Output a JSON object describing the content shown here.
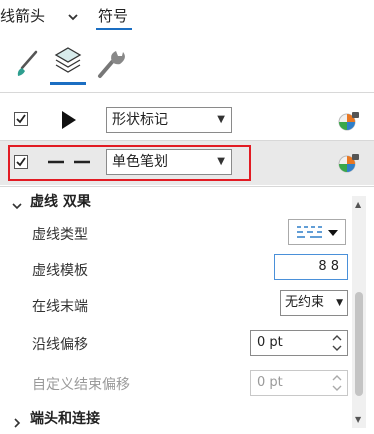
{
  "tabs": [
    {
      "label": "线箭头",
      "active": false
    },
    {
      "label": "符号",
      "active": true
    }
  ],
  "tab_dropdown_icon": "chevron-down-icon",
  "icon_tabs": [
    {
      "name": "brush-icon",
      "active": false
    },
    {
      "name": "layers-icon",
      "active": true
    },
    {
      "name": "wrench-icon",
      "active": false
    }
  ],
  "layers": [
    {
      "checked": true,
      "preview": "arrowhead",
      "type": "形状标记",
      "selected": false
    },
    {
      "checked": true,
      "preview": "dashed-line",
      "type": "单色笔划",
      "selected": true
    }
  ],
  "dash_effect": {
    "title": "虚线 双果",
    "dash_type_label": "虚线类型",
    "dash_template_label": "虚线模板",
    "dash_template_value": "8 8",
    "line_end_label": "在线末端",
    "line_end_value": "无约束",
    "offset_label": "沿线偏移",
    "offset_value": "0 pt",
    "custom_offset_label": "自定义结束偏移",
    "custom_offset_value": "0 pt"
  },
  "caps_section": {
    "title": "端头和连接"
  },
  "colors": {
    "accent": "#1b6ec2",
    "highlight": "#e21b23",
    "tab_underline": "#1b6ec2"
  }
}
